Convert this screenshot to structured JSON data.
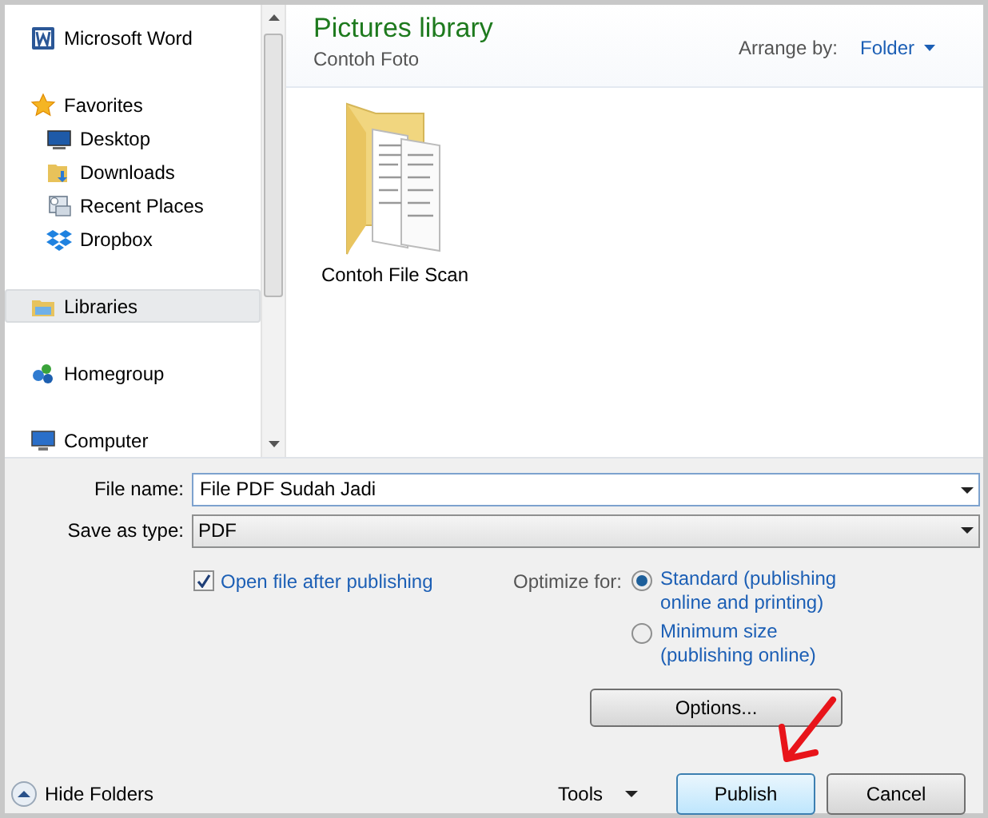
{
  "sidebar": {
    "items": [
      {
        "label": "Microsoft Word",
        "selected": false
      },
      {
        "label": "Favorites",
        "selected": false,
        "children": [
          {
            "label": "Desktop",
            "selected": false
          },
          {
            "label": "Downloads",
            "selected": false
          },
          {
            "label": "Recent Places",
            "selected": false
          },
          {
            "label": "Dropbox",
            "selected": false
          }
        ]
      },
      {
        "label": "Libraries",
        "selected": true
      },
      {
        "label": "Homegroup",
        "selected": false
      },
      {
        "label": "Computer",
        "selected": false
      }
    ]
  },
  "library": {
    "title": "Pictures library",
    "subtitle": "Contoh Foto",
    "arrange_label": "Arrange by:",
    "arrange_value": "Folder"
  },
  "files": [
    {
      "name": "Contoh File Scan"
    }
  ],
  "form": {
    "file_name_label": "File name:",
    "file_name": "File PDF Sudah Jadi",
    "type_label": "Save as type:",
    "type_value": "PDF"
  },
  "options": {
    "open_after": {
      "label": "Open file after publishing",
      "checked": true
    },
    "optimize_label": "Optimize for:",
    "radios": [
      {
        "label": "Standard (publishing online and printing)",
        "selected": true
      },
      {
        "label": "Minimum size (publishing online)",
        "selected": false
      }
    ],
    "options_button": "Options..."
  },
  "footer": {
    "hide_folders": "Hide Folders",
    "tools": "Tools",
    "publish": "Publish",
    "cancel": "Cancel"
  }
}
